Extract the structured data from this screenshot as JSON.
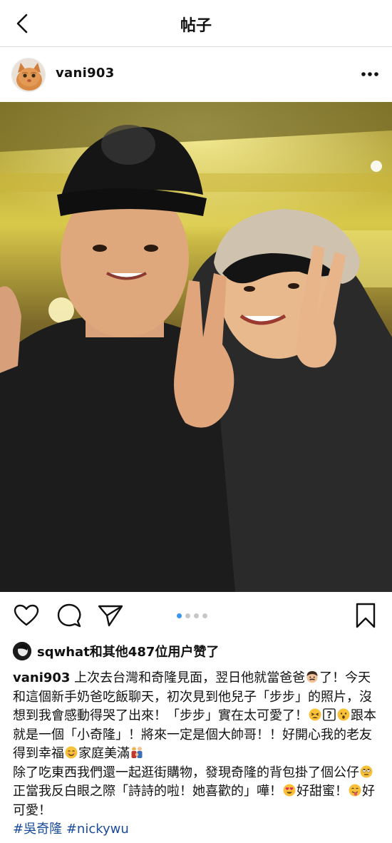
{
  "header": {
    "title": "帖子"
  },
  "post": {
    "username": "vani903",
    "liked_by_user": "sqwhat",
    "likes_text": "sqwhat和其他487位用户赞了",
    "carousel": {
      "count": 4,
      "active": 1
    }
  },
  "caption": {
    "username": "vani903",
    "p1_a": " 上次去台灣和奇隆見面，翌日他就當爸爸",
    "p1_b": "了！今天和這個新手奶爸吃飯聊天，初次見到他兒子「步步」的照片，沒想到我會感動得哭了出來！「步步」實在太可愛了！",
    "p1_c": "跟本就是一個「小奇隆」！將來一定是個大帥哥！！好開心我的老友得到幸福",
    "p1_d": "家庭美滿",
    "p2_a": "除了吃東西我們還一起逛街購物，發現奇隆的背包掛了個公仔",
    "p2_b": "正當我反白眼之際「詩詩的啦！她喜歡的」嘩！",
    "p2_c": "好甜蜜！",
    "p2_d": "好可愛！",
    "tags": [
      "#吳奇隆",
      "#nickywu"
    ]
  },
  "icons": {
    "back": "chevron-left-icon",
    "more": "more-horizontal-icon",
    "like": "heart-icon",
    "comment": "comment-icon",
    "share": "send-icon",
    "save": "bookmark-icon"
  },
  "colors": {
    "accent": "#3897f0",
    "hashtag": "#1a4b9a",
    "divider": "#dbdbdb"
  }
}
